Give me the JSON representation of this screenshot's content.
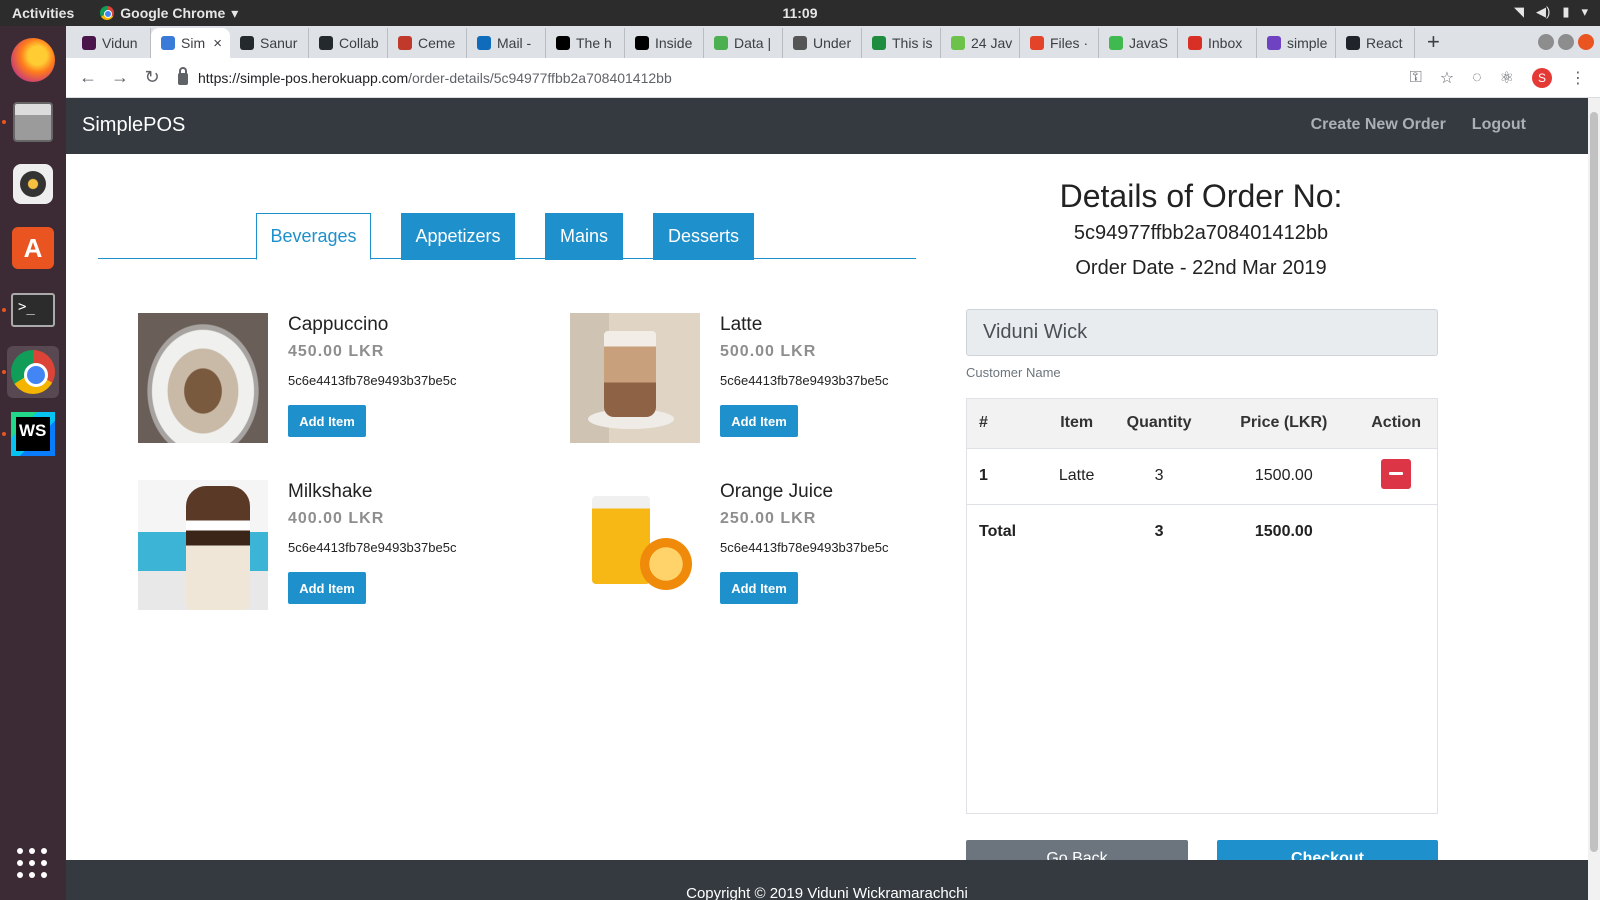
{
  "desktop": {
    "activities": "Activities",
    "app_name": "Google Chrome",
    "clock": "11:09"
  },
  "browser": {
    "tabs": [
      {
        "label": "Vidun",
        "favicon_color": "#4a154b"
      },
      {
        "label": "Sim",
        "favicon_color": "#3b7bd8",
        "active": true
      },
      {
        "label": "Sanur",
        "favicon_color": "#24292e"
      },
      {
        "label": "Collab",
        "favicon_color": "#24292e"
      },
      {
        "label": "Ceme",
        "favicon_color": "#c0392b"
      },
      {
        "label": "Mail -",
        "favicon_color": "#0f6cbd"
      },
      {
        "label": "The h",
        "favicon_color": "#000000"
      },
      {
        "label": "Inside",
        "favicon_color": "#000000"
      },
      {
        "label": "Data |",
        "favicon_color": "#4caf50"
      },
      {
        "label": "Under",
        "favicon_color": "#555555"
      },
      {
        "label": "This is",
        "favicon_color": "#1e8e3e"
      },
      {
        "label": "24 Jav",
        "favicon_color": "#6cc24a"
      },
      {
        "label": "Files ·",
        "favicon_color": "#e24329"
      },
      {
        "label": "JavaS",
        "favicon_color": "#3fb950"
      },
      {
        "label": "Inbox",
        "favicon_color": "#d93025"
      },
      {
        "label": "simple",
        "favicon_color": "#6f42c1"
      },
      {
        "label": "React",
        "favicon_color": "#20232a"
      }
    ],
    "url_host": "https://simple-pos.herokuapp.com",
    "url_path": "/order-details/5c94977ffbb2a708401412bb",
    "profile_initial": "S"
  },
  "app": {
    "brand": "SimplePOS",
    "nav": {
      "create_order": "Create New Order",
      "logout": "Logout"
    },
    "categories": [
      {
        "label": "Beverages",
        "active": true
      },
      {
        "label": "Appetizers",
        "active": false
      },
      {
        "label": "Mains",
        "active": false
      },
      {
        "label": "Desserts",
        "active": false
      }
    ],
    "products": [
      {
        "name": "Cappuccino",
        "price": "450.00 LKR",
        "id": "5c6e4413fb78e9493b37be5c",
        "button": "Add Item"
      },
      {
        "name": "Latte",
        "price": "500.00 LKR",
        "id": "5c6e4413fb78e9493b37be5c",
        "button": "Add Item"
      },
      {
        "name": "Milkshake",
        "price": "400.00 LKR",
        "id": "5c6e4413fb78e9493b37be5c",
        "button": "Add Item"
      },
      {
        "name": "Orange Juice",
        "price": "250.00 LKR",
        "id": "5c6e4413fb78e9493b37be5c",
        "button": "Add Item"
      }
    ],
    "order": {
      "title": "Details of Order No:",
      "id": "5c94977ffbb2a708401412bb",
      "date": "Order Date - 22nd Mar 2019",
      "customer_name": "Viduni Wick",
      "customer_label": "Customer Name",
      "columns": [
        "#",
        "Item",
        "Quantity",
        "Price (LKR)",
        "Action"
      ],
      "rows": [
        {
          "num": "1",
          "item": "Latte",
          "qty": "3",
          "price": "1500.00"
        }
      ],
      "total": {
        "label": "Total",
        "qty": "3",
        "price": "1500.00"
      },
      "go_back": "Go Back",
      "checkout": "Checkout"
    },
    "footer": "Copyright © 2019 Viduni Wickramarachchi"
  },
  "colors": {
    "primary": "#1e90cc",
    "navbar": "#343a40",
    "danger": "#dc3545",
    "secondary": "#6c757d"
  }
}
